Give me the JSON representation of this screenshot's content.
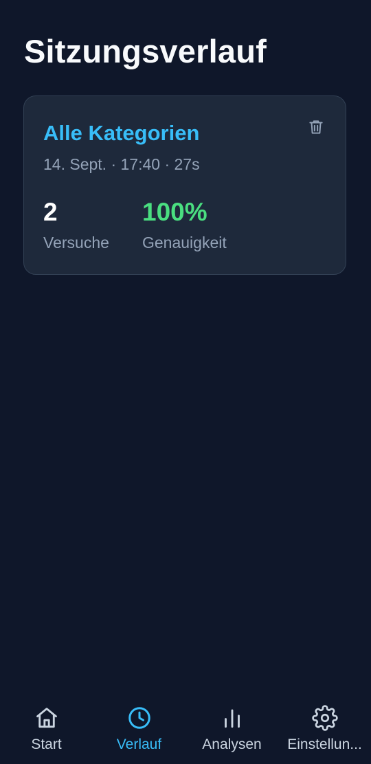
{
  "page": {
    "title": "Sitzungsverlauf"
  },
  "session": {
    "title": "Alle Kategorien",
    "meta": "14. Sept. · 17:40 · 27s",
    "attempts_value": "2",
    "attempts_label": "Versuche",
    "accuracy_value": "100%",
    "accuracy_label": "Genauigkeit",
    "delete_icon": "trash-icon"
  },
  "nav": {
    "items": [
      {
        "label": "Start",
        "icon": "home-icon",
        "active": false
      },
      {
        "label": "Verlauf",
        "icon": "clock-icon",
        "active": true
      },
      {
        "label": "Analysen",
        "icon": "bar-chart-icon",
        "active": false
      },
      {
        "label": "Einstellun...",
        "icon": "gear-icon",
        "active": false
      }
    ]
  },
  "colors": {
    "background": "#0f172a",
    "card": "#1e293b",
    "accent": "#38bdf8",
    "success": "#4ade80",
    "muted": "#94a3b8"
  }
}
